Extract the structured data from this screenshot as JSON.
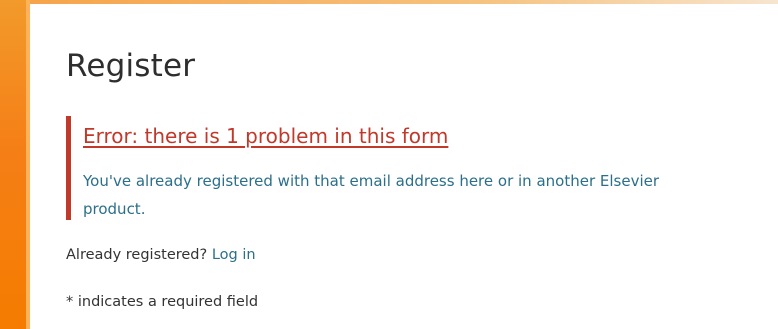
{
  "form": {
    "title": "Register",
    "error": {
      "heading": "Error: there is 1 problem in this form",
      "message": "You've already registered with that email address here or in another Elsevier product."
    },
    "already_registered_text": "Already registered?",
    "login_link": "Log in",
    "required_note": "* indicates a required field"
  },
  "colors": {
    "accent": "#f57c00",
    "error": "#c0392b",
    "link": "#2b6f8a"
  }
}
